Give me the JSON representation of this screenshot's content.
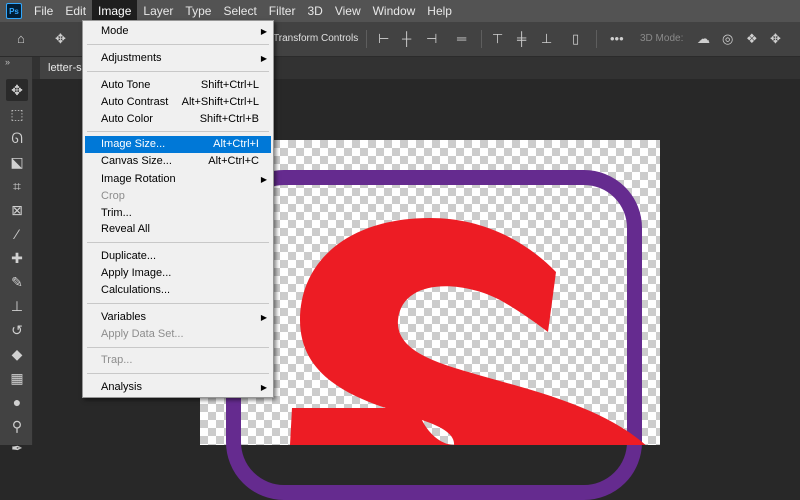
{
  "app": {
    "logo": "Ps"
  },
  "menubar": [
    "File",
    "Edit",
    "Image",
    "Layer",
    "Type",
    "Select",
    "Filter",
    "3D",
    "View",
    "Window",
    "Help"
  ],
  "options_bar": {
    "transform_controls_label": "Transform Controls",
    "mode_label": "3D Mode:"
  },
  "document": {
    "tab_label": "letter-s."
  },
  "image_menu": {
    "items": [
      {
        "label": "Mode",
        "shortcut": "",
        "submenu": true,
        "disabled": false
      },
      {
        "label": "Adjustments",
        "shortcut": "",
        "submenu": true,
        "disabled": false
      },
      {
        "label": "Auto Tone",
        "shortcut": "Shift+Ctrl+L",
        "submenu": false,
        "disabled": false
      },
      {
        "label": "Auto Contrast",
        "shortcut": "Alt+Shift+Ctrl+L",
        "submenu": false,
        "disabled": false
      },
      {
        "label": "Auto Color",
        "shortcut": "Shift+Ctrl+B",
        "submenu": false,
        "disabled": false
      },
      {
        "label": "Image Size...",
        "shortcut": "Alt+Ctrl+I",
        "submenu": false,
        "disabled": false,
        "highlighted": true
      },
      {
        "label": "Canvas Size...",
        "shortcut": "Alt+Ctrl+C",
        "submenu": false,
        "disabled": false
      },
      {
        "label": "Image Rotation",
        "shortcut": "",
        "submenu": true,
        "disabled": false
      },
      {
        "label": "Crop",
        "shortcut": "",
        "submenu": false,
        "disabled": true
      },
      {
        "label": "Trim...",
        "shortcut": "",
        "submenu": false,
        "disabled": false
      },
      {
        "label": "Reveal All",
        "shortcut": "",
        "submenu": false,
        "disabled": false
      },
      {
        "label": "Duplicate...",
        "shortcut": "",
        "submenu": false,
        "disabled": false
      },
      {
        "label": "Apply Image...",
        "shortcut": "",
        "submenu": false,
        "disabled": false
      },
      {
        "label": "Calculations...",
        "shortcut": "",
        "submenu": false,
        "disabled": false
      },
      {
        "label": "Variables",
        "shortcut": "",
        "submenu": true,
        "disabled": false
      },
      {
        "label": "Apply Data Set...",
        "shortcut": "",
        "submenu": false,
        "disabled": true
      },
      {
        "label": "Trap...",
        "shortcut": "",
        "submenu": false,
        "disabled": true
      },
      {
        "label": "Analysis",
        "shortcut": "",
        "submenu": true,
        "disabled": false
      }
    ]
  },
  "artwork": {
    "letter": "S",
    "letter_color": "#ed1c24",
    "frame_color": "#652b8f"
  },
  "colors": {
    "menu_highlight": "#0078d7",
    "menubar_bg": "#535353",
    "workspace_bg": "#282828"
  }
}
